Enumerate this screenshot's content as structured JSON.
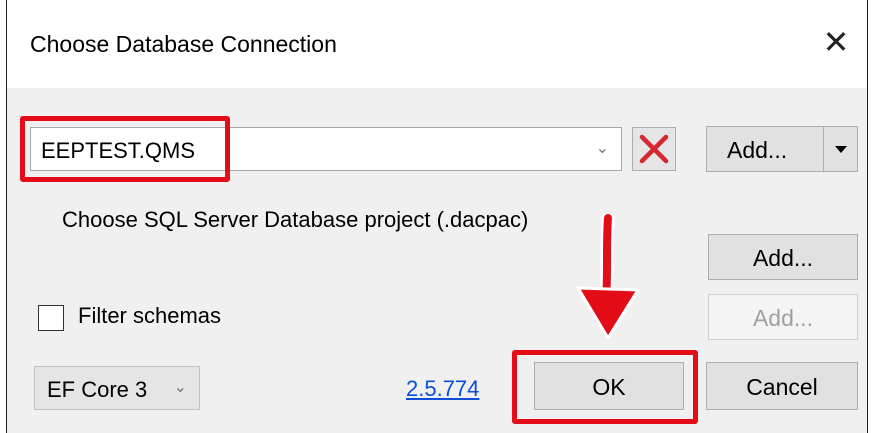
{
  "dialog": {
    "title": "Choose Database Connection",
    "close_symbol": "✕"
  },
  "connection": {
    "selected": "EEPTEST.QMS",
    "dropdown_arrow": "⌄",
    "delete_icon": "x-icon",
    "add_label": "Add...",
    "add_dropdown_icon": "caret-down-icon"
  },
  "dacpac": {
    "label": "Choose SQL Server Database project (.dacpac)",
    "add_label": "Add...",
    "add_disabled_label": "Add..."
  },
  "filter": {
    "label": "Filter schemas",
    "checked": false
  },
  "footer": {
    "ef_version": "EF Core 3",
    "ef_arrow": "⌄",
    "version_link": "2.5.774",
    "ok_label": "OK",
    "cancel_label": "Cancel"
  },
  "colors": {
    "highlight_red": "#e40d17",
    "link_blue": "#0b4fd8",
    "delete_red": "#d8262f"
  }
}
